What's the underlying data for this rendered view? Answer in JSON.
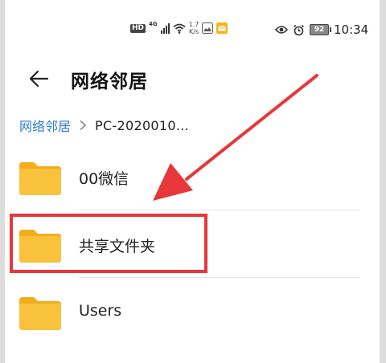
{
  "status_bar": {
    "hd_badge": "HD",
    "network_type": "4G",
    "net_speed_value": "1.7",
    "net_speed_unit": "K/s",
    "battery_level": "92",
    "clock": "10:34",
    "icons": [
      "hd-icon",
      "signal-icon",
      "wifi-icon",
      "gallery-app-icon",
      "mail-app-icon",
      "eye-comfort-icon",
      "alarm-icon",
      "battery-icon"
    ]
  },
  "app_bar": {
    "title": "网络邻居",
    "back_icon": "arrow-left-icon"
  },
  "breadcrumb": {
    "root_label": "网络邻居",
    "separator_icon": "chevron-right-icon",
    "current_label": "PC-2020010..."
  },
  "files": [
    {
      "name": "00微信",
      "icon": "folder-icon"
    },
    {
      "name": "共享文件夹",
      "icon": "folder-icon"
    },
    {
      "name": "Users",
      "icon": "folder-icon"
    }
  ],
  "colors": {
    "folder": "#f9c23c",
    "folder_tab": "#f2ad1d",
    "link": "#2d7bd6",
    "annotation": "#e8373b"
  }
}
